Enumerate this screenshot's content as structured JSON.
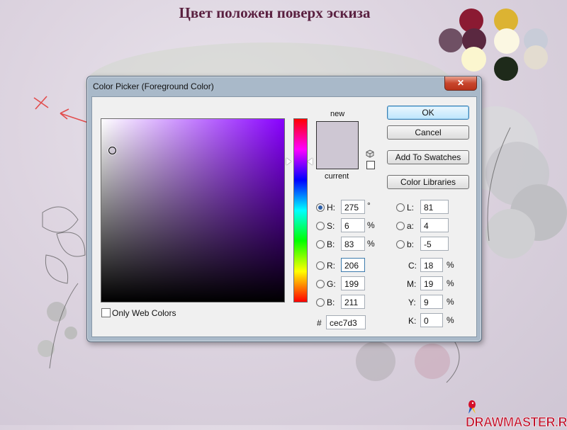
{
  "page": {
    "title": "Цвет положен поверх эскиза",
    "watermark": "DRAWMASTER.RU"
  },
  "palette": [
    "#8b1a32",
    "#dcb332",
    "#6f5064",
    "#5a2840",
    "#fbf7e2",
    "#c8ccd8",
    "#fbf6cf",
    "#1e2a1a",
    "#e3dcd0"
  ],
  "dialog": {
    "title": "Color Picker (Foreground Color)",
    "close_glyph": "✕",
    "new_label": "new",
    "current_label": "current",
    "new_color": "#cec7d3",
    "current_color": "#cec7d3",
    "buttons": {
      "ok": "OK",
      "cancel": "Cancel",
      "add_to_swatches": "Add To Swatches",
      "color_libraries": "Color Libraries"
    },
    "only_web_colors": "Only Web Colors",
    "fields": {
      "H": {
        "label": "H:",
        "value": "275",
        "unit": "°",
        "selected": true
      },
      "S": {
        "label": "S:",
        "value": "6",
        "unit": "%",
        "selected": false
      },
      "Bv": {
        "label": "B:",
        "value": "83",
        "unit": "%",
        "selected": false
      },
      "R": {
        "label": "R:",
        "value": "206",
        "selected": false
      },
      "G": {
        "label": "G:",
        "value": "199",
        "selected": false
      },
      "Bl": {
        "label": "B:",
        "value": "211",
        "selected": false
      },
      "L": {
        "label": "L:",
        "value": "81",
        "selected": false
      },
      "a": {
        "label": "a:",
        "value": "4",
        "selected": false
      },
      "b": {
        "label": "b:",
        "value": "-5",
        "selected": false
      },
      "C": {
        "label": "C:",
        "value": "18",
        "unit": "%"
      },
      "M": {
        "label": "M:",
        "value": "19",
        "unit": "%"
      },
      "Y": {
        "label": "Y:",
        "value": "9",
        "unit": "%"
      },
      "K": {
        "label": "K:",
        "value": "0",
        "unit": "%"
      }
    },
    "hex_label": "#",
    "hex_value": "cec7d3",
    "hue_fraction": 0.236,
    "saturation_fraction": 0.06,
    "brightness_fraction": 0.83
  }
}
